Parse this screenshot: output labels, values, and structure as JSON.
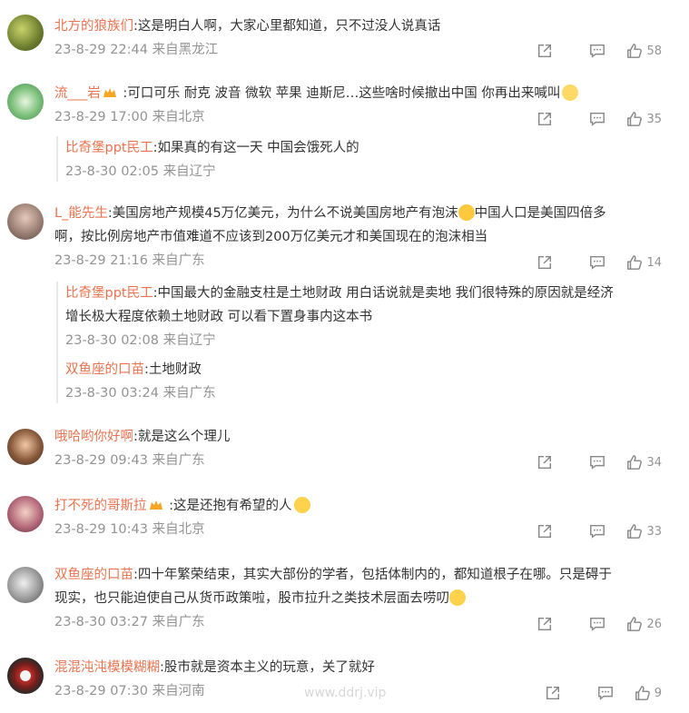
{
  "comments": [
    {
      "user": "北方的狼族们",
      "text": ":这是明白人啊，大家心里都知道，只不过没人说真话",
      "time": "23-8-29 22:44",
      "loc": "来自黑龙江",
      "likes": "58"
    },
    {
      "user": "流___岩",
      "text": " :可口可乐  耐克  波音  微软   苹果  迪斯尼…这些啥时候撤出中国  你再出来喊叫",
      "time": "23-8-29 17:00",
      "loc": "来自北京",
      "likes": "35",
      "reply": {
        "user": "比奇堡ppt民工",
        "text": ":如果真的有这一天 中国会饿死人的",
        "time": "23-8-30 02:05",
        "loc": "来自辽宁"
      }
    },
    {
      "user": "L_能先生",
      "text": ":美国房地产规模45万亿美元，为什么不说美国房地产有泡沫",
      "text2": "中国人口是美国四倍多",
      "line2": "啊，按比例房地产市值难道不应该到200万亿美元才和美国现在的泡沫相当",
      "time": "23-8-29 21:16",
      "loc": "来自广东",
      "likes": "14",
      "replies": [
        {
          "user": "比奇堡ppt民工",
          "text": ":中国最大的金融支柱是土地财政 用白话说就是卖地 我们很特殊的原因就是经济",
          "line2": "增长极大程度依赖土地财政 可以看下置身事内这本书",
          "time": "23-8-30 02:08",
          "loc": "来自辽宁"
        },
        {
          "user": "双鱼座的口苗",
          "text": ":土地财政",
          "time": "23-8-30 03:24",
          "loc": "来自广东"
        }
      ]
    },
    {
      "user": "哦哈哟你好啊",
      "text": ":就是这么个理儿",
      "time": "23-8-29 09:43",
      "loc": "来自广东",
      "likes": "34"
    },
    {
      "user": "打不死的哥斯拉",
      "text": " :这是还抱有希望的人",
      "time": "23-8-29 10:43",
      "loc": "来自北京",
      "likes": "33"
    },
    {
      "user": "双鱼座的口苗",
      "text": ":四十年繁荣结束，其实大部份的学者，包括体制内的，都知道根子在哪。只是碍于",
      "line2": "现实，也只能迫使自己从货币政策啦，股市拉升之类技术层面去唠叨",
      "time": "23-8-30 03:27",
      "loc": "来自广东",
      "likes": "26"
    },
    {
      "user": "混混沌沌模模糊糊",
      "text": ":股市就是资本主义的玩意，关了就好",
      "time": "23-8-29 07:30",
      "loc": "来自河南",
      "likes": "9"
    }
  ],
  "watermark": "www.ddrj.vip",
  "colors": {
    "username": "#eb7350",
    "meta": "#939393",
    "text": "#333333"
  },
  "icons": [
    "share-icon",
    "comment-icon",
    "like-icon"
  ]
}
